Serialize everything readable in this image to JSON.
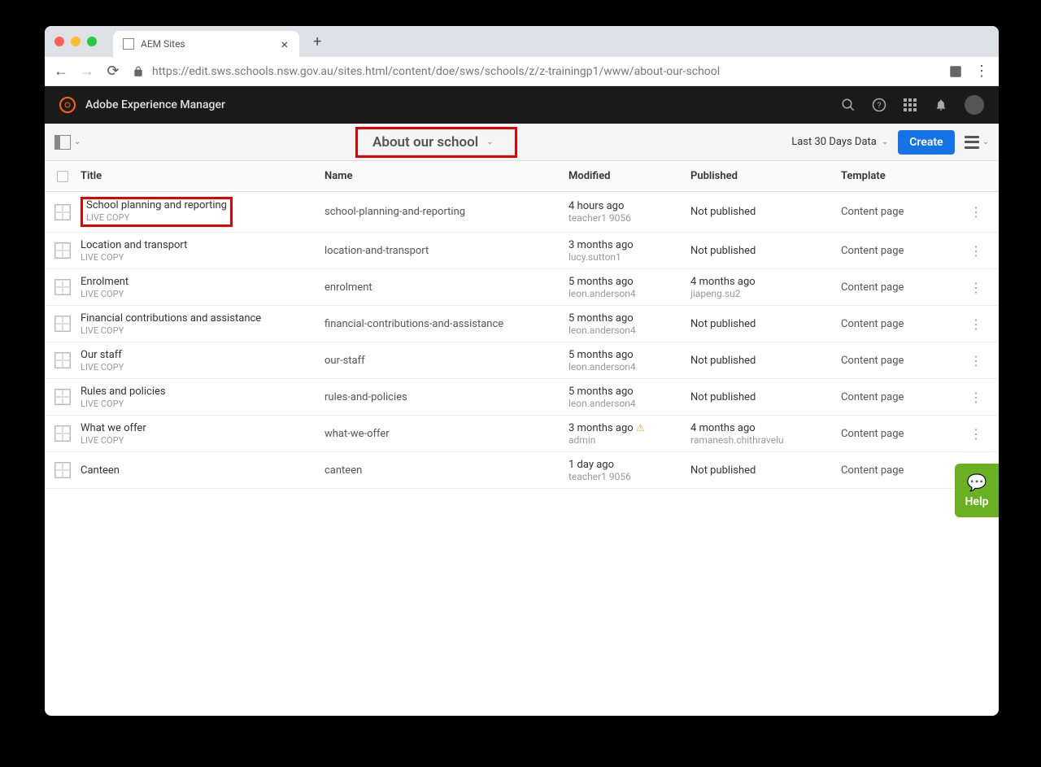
{
  "browser": {
    "tab_title": "AEM Sites",
    "url": "https://edit.sws.schools.nsw.gov.au/sites.html/content/doe/sws/schools/z/z-trainingp1/www/about-our-school"
  },
  "aem_header": {
    "product": "Adobe Experience Manager"
  },
  "action_bar": {
    "breadcrumb": "About our school",
    "filter": "Last 30 Days Data",
    "create": "Create"
  },
  "columns": {
    "title": "Title",
    "name": "Name",
    "modified": "Modified",
    "published": "Published",
    "template": "Template"
  },
  "rows": [
    {
      "title": "School planning and reporting",
      "subtitle": "LIVE COPY",
      "name": "school-planning-and-reporting",
      "modified": "4 hours ago",
      "modified_by": "teacher1 9056",
      "published": "Not published",
      "published_by": "",
      "template": "Content page",
      "highlight": true,
      "warn": false
    },
    {
      "title": "Location and transport",
      "subtitle": "LIVE COPY",
      "name": "location-and-transport",
      "modified": "3 months ago",
      "modified_by": "lucy.sutton1",
      "published": "Not published",
      "published_by": "",
      "template": "Content page",
      "highlight": false,
      "warn": false
    },
    {
      "title": "Enrolment",
      "subtitle": "LIVE COPY",
      "name": "enrolment",
      "modified": "5 months ago",
      "modified_by": "leon.anderson4",
      "published": "4 months ago",
      "published_by": "jiapeng.su2",
      "template": "Content page",
      "highlight": false,
      "warn": false
    },
    {
      "title": "Financial contributions and assistance",
      "subtitle": "LIVE COPY",
      "name": "financial-contributions-and-assistance",
      "modified": "5 months ago",
      "modified_by": "leon.anderson4",
      "published": "Not published",
      "published_by": "",
      "template": "Content page",
      "highlight": false,
      "warn": false
    },
    {
      "title": "Our staff",
      "subtitle": "LIVE COPY",
      "name": "our-staff",
      "modified": "5 months ago",
      "modified_by": "leon.anderson4",
      "published": "Not published",
      "published_by": "",
      "template": "Content page",
      "highlight": false,
      "warn": false
    },
    {
      "title": "Rules and policies",
      "subtitle": "LIVE COPY",
      "name": "rules-and-policies",
      "modified": "5 months ago",
      "modified_by": "leon.anderson4",
      "published": "Not published",
      "published_by": "",
      "template": "Content page",
      "highlight": false,
      "warn": false
    },
    {
      "title": "What we offer",
      "subtitle": "LIVE COPY",
      "name": "what-we-offer",
      "modified": "3 months ago",
      "modified_by": "admin",
      "published": "4 months ago",
      "published_by": "ramanesh.chithravelu",
      "template": "Content page",
      "highlight": false,
      "warn": true
    },
    {
      "title": "Canteen",
      "subtitle": "",
      "name": "canteen",
      "modified": "1 day ago",
      "modified_by": "teacher1 9056",
      "published": "Not published",
      "published_by": "",
      "template": "Content page",
      "highlight": false,
      "warn": false
    }
  ],
  "help": {
    "label": "Help"
  }
}
